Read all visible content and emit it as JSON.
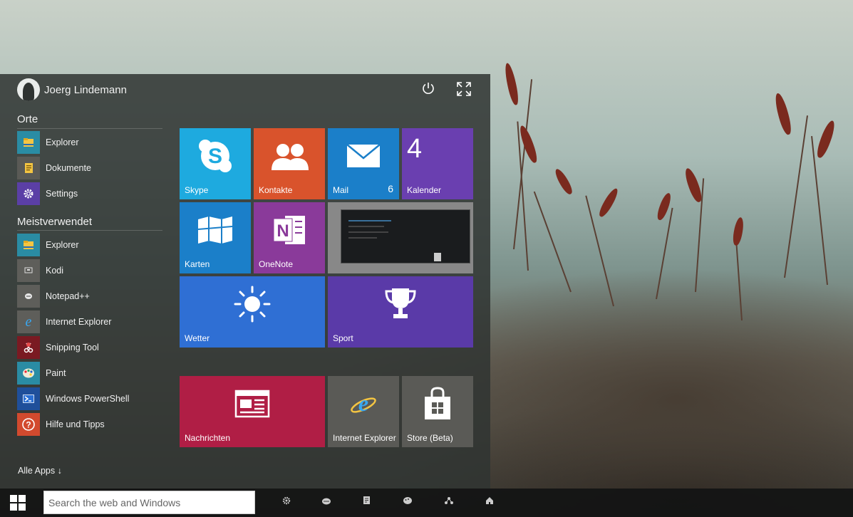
{
  "user": {
    "name": "Joerg Lindemann"
  },
  "sections": {
    "places_title": "Orte",
    "most_used_title": "Meistverwendet"
  },
  "places": [
    {
      "label": "Explorer",
      "icon": "folder-icon",
      "color": "#2a8ca4"
    },
    {
      "label": "Dokumente",
      "icon": "documents-icon",
      "color": "#5a5a56"
    },
    {
      "label": "Settings",
      "icon": "gear-icon",
      "color": "#5b3fa6"
    }
  ],
  "most_used": [
    {
      "label": "Explorer",
      "icon": "folder-icon",
      "color": "#2a8ca4"
    },
    {
      "label": "Kodi",
      "icon": "kodi-icon",
      "color": "#5e5e5a"
    },
    {
      "label": "Notepad++",
      "icon": "notepad-icon",
      "color": "#5e5e5a"
    },
    {
      "label": "Internet Explorer",
      "icon": "ie-icon",
      "color": "#5e5e5a"
    },
    {
      "label": "Snipping Tool",
      "icon": "scissors-icon",
      "color": "#7a1a22"
    },
    {
      "label": "Paint",
      "icon": "palette-icon",
      "color": "#2a8ca4"
    },
    {
      "label": "Windows PowerShell",
      "icon": "powershell-icon",
      "color": "#1f4f9a"
    },
    {
      "label": "Hilfe und Tipps",
      "icon": "help-icon",
      "color": "#d24a2e"
    }
  ],
  "all_apps": "Alle Apps ↓",
  "tiles": {
    "skype": {
      "label": "Skype",
      "color": "#1eaadf"
    },
    "kontakte": {
      "label": "Kontakte",
      "color": "#d9532c"
    },
    "mail": {
      "label": "Mail",
      "badge": "6",
      "color": "#1b7fc9"
    },
    "kalender": {
      "label": "Kalender",
      "day": "4",
      "color": "#6a3fb0"
    },
    "karten": {
      "label": "Karten",
      "color": "#1b7fc9"
    },
    "onenote": {
      "label": "OneNote",
      "color": "#8a3a9a"
    },
    "wetter": {
      "label": "Wetter",
      "color": "#2f6fd4"
    },
    "sport": {
      "label": "Sport",
      "color": "#5a3aa8"
    },
    "nachrichten": {
      "label": "Nachrichten",
      "color": "#b01e45"
    },
    "internet_explorer": {
      "label": "Internet Explorer",
      "color": "#5a5a56"
    },
    "store": {
      "label": "Store (Beta)",
      "color": "#5a5a56"
    }
  },
  "taskbar": {
    "search_placeholder": "Search the web and Windows",
    "icons": [
      "settings-icon",
      "kodi-icon",
      "documents-icon",
      "paint-icon",
      "network-icon",
      "home-icon"
    ]
  }
}
